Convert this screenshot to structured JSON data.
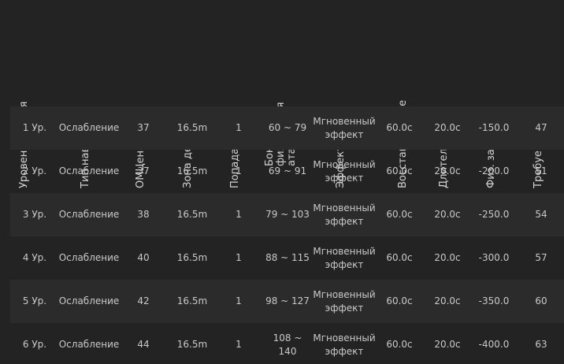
{
  "headers": [
    {
      "key": "level",
      "label": "Уровень умения"
    },
    {
      "key": "type",
      "label": "Тип навыка"
    },
    {
      "key": "mp",
      "label": "ОМЦена"
    },
    {
      "key": "range",
      "label": "Зона действия"
    },
    {
      "key": "hits",
      "label": "Попадания"
    },
    {
      "key": "bonus",
      "label": "Бонусная физическая атака"
    },
    {
      "key": "effect",
      "label": "Эффект"
    },
    {
      "key": "cooldown",
      "label": "Восстановление"
    },
    {
      "key": "duration",
      "label": "Длительность"
    },
    {
      "key": "pdef",
      "label": "Физ. защита"
    },
    {
      "key": "req",
      "label": "Требуемый ур."
    }
  ],
  "rows": [
    {
      "level": "1 Ур.",
      "type": "Ослабление",
      "mp": "37",
      "range": "16.5m",
      "hits": "1",
      "bonus": "60 ~ 79",
      "effect": "Мгновенный эффект",
      "cooldown": "60.0с",
      "duration": "20.0с",
      "pdef": "-150.0",
      "req": "47"
    },
    {
      "level": "2 Ур.",
      "type": "Ослабление",
      "mp": "37",
      "range": "16.5m",
      "hits": "1",
      "bonus": "69 ~ 91",
      "effect": "Мгновенный эффект",
      "cooldown": "60.0с",
      "duration": "20.0с",
      "pdef": "-200.0",
      "req": "51"
    },
    {
      "level": "3 Ур.",
      "type": "Ослабление",
      "mp": "38",
      "range": "16.5m",
      "hits": "1",
      "bonus": "79 ~ 103",
      "effect": "Мгновенный эффект",
      "cooldown": "60.0с",
      "duration": "20.0с",
      "pdef": "-250.0",
      "req": "54"
    },
    {
      "level": "4 Ур.",
      "type": "Ослабление",
      "mp": "40",
      "range": "16.5m",
      "hits": "1",
      "bonus": "88 ~ 115",
      "effect": "Мгновенный эффект",
      "cooldown": "60.0с",
      "duration": "20.0с",
      "pdef": "-300.0",
      "req": "57"
    },
    {
      "level": "5 Ур.",
      "type": "Ослабление",
      "mp": "42",
      "range": "16.5m",
      "hits": "1",
      "bonus": "98 ~ 127",
      "effect": "Мгновенный эффект",
      "cooldown": "60.0с",
      "duration": "20.0с",
      "pdef": "-350.0",
      "req": "60"
    },
    {
      "level": "6 Ур.",
      "type": "Ослабление",
      "mp": "44",
      "range": "16.5m",
      "hits": "1",
      "bonus": "108 ~ 140",
      "effect": "Мгновенный эффект",
      "cooldown": "60.0с",
      "duration": "20.0с",
      "pdef": "-400.0",
      "req": "63"
    }
  ]
}
